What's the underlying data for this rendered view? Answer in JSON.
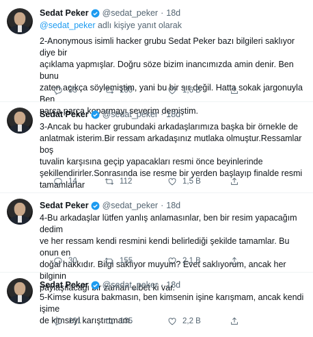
{
  "author": {
    "name": "Sedat Peker",
    "handle": "@sedat_peker",
    "dot": "·"
  },
  "tweets": [
    {
      "time": "18d",
      "reply_prefix": "@sedat_peker",
      "reply_suffix": " adlı kişiye yanıt olarak",
      "text": "2-Anonymous isimli hacker grubu Sedat Peker bazı bilgileri saklıyor diye bir\naçıklama yapmışlar. Doğru söze bizim inancımızda amin denir. Ben bunu\nzaten açıkça söylemiştim, yani bu bir sır değil. Hatta sokak jargonuyla Ben\nparça parça koparmayı severim demiştim.",
      "replies": "33",
      "retweets": "130",
      "likes": "1,6 B"
    },
    {
      "time": "18d",
      "text": "3-Ancak bu hacker grubundaki arkadaşlarımıza başka bir örnekle de\nanlatmak isterim.Bir ressam arkadaşınız mutlaka olmuştur.Ressamlar boş\ntuvalin karşısına geçip yapacakları resmi önce beyinlerinde\nşekillendirirler.Sonrasında ise resme bir yerden başlayıp finalde resmi\ntamamlarlar",
      "replies": "14",
      "retweets": "112",
      "likes": "1,5 B"
    },
    {
      "time": "18d",
      "text": "4-Bu arkadaşlar lütfen yanlış anlamasınlar, ben bir resim yapacağım dedim\nve her ressam kendi resmini kendi belirlediği şekilde tamamlar. Bu onun en\ndoğal hakkıdır. Bilgi saklıyor muyum? Evet saklıyorum, ancak her bilginin\npaylaşılacağı bir zaman elbet ki var.",
      "replies": "30",
      "retweets": "155",
      "likes": "2,1 B"
    },
    {
      "time": "18d",
      "text": "5-Kimse kusura bakmasın, ben kimsenin işine karışmam, ancak kendi işime\nde kimseyi karıştırtmam.",
      "replies": "101",
      "retweets": "135",
      "likes": "2,2 B"
    }
  ],
  "icons": {
    "verified": "verified-badge-icon",
    "reply": "reply-icon",
    "retweet": "retweet-icon",
    "like": "like-icon",
    "share": "share-icon"
  },
  "colors": {
    "accent": "#1d9bf0",
    "secondary_text": "#536471",
    "divider": "#eff3f4"
  }
}
